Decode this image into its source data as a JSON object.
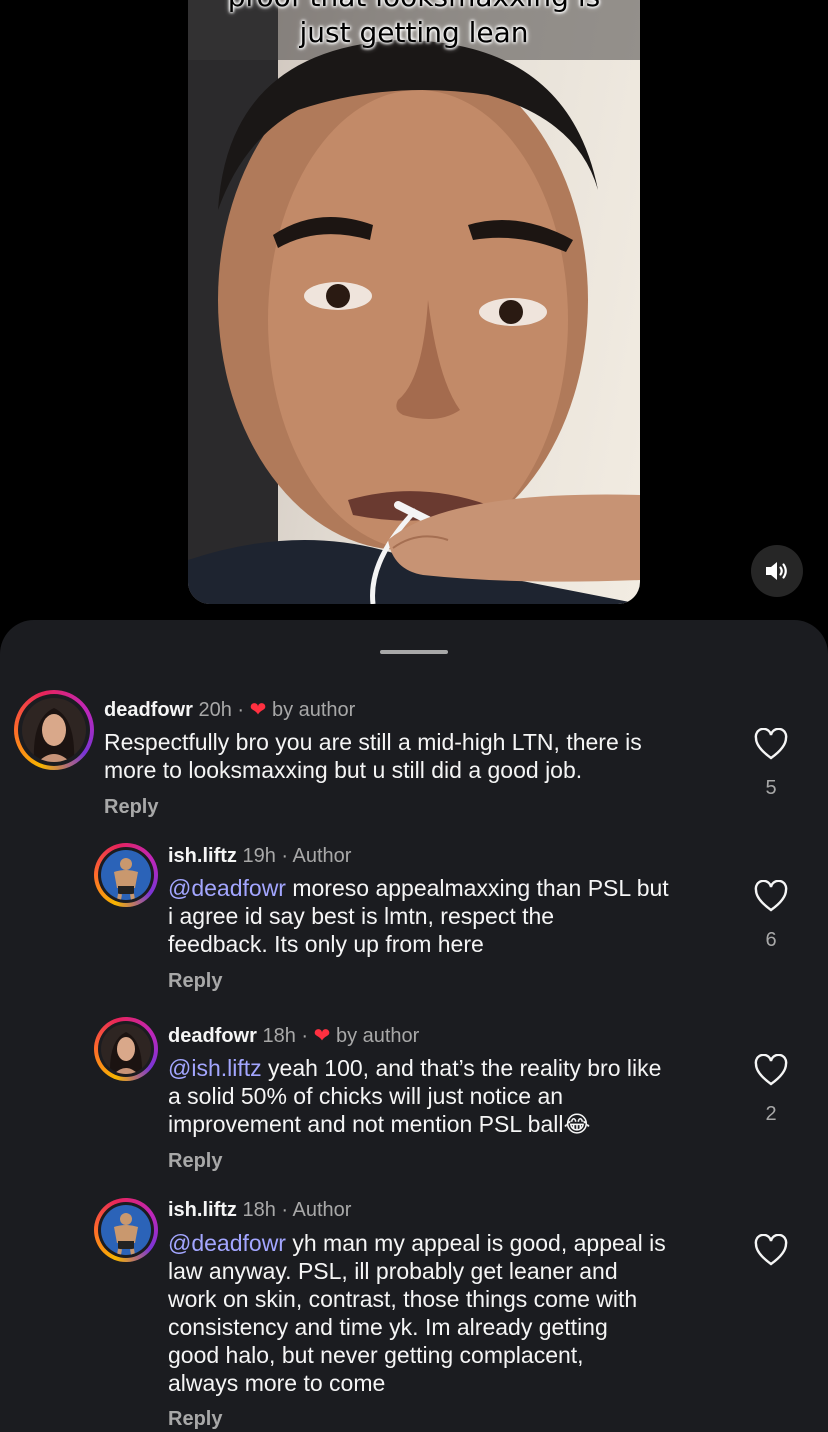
{
  "video": {
    "caption_line1": "proof that looksmaxxing is",
    "caption_line2": "just getting lean",
    "mute_icon": "speaker-volume-icon"
  },
  "comments": [
    {
      "username": "deadfowr",
      "time": "20h",
      "tag": "by author",
      "liked_by_author": true,
      "segments": [
        {
          "type": "text",
          "value": "Respectfully bro you are still a mid-high LTN, there is"
        },
        {
          "type": "text",
          "value": "more to looksmaxxing but u still did a good job."
        }
      ],
      "reply_label": "Reply",
      "likes": "5"
    },
    {
      "username": "ish.liftz",
      "time": "19h",
      "tag": "Author",
      "mention": "@deadfowr",
      "lines": [
        " moreso appealmaxxing than PSL but",
        "i agree id say best is lmtn, respect the",
        "feedback. Its only up from here"
      ],
      "reply_label": "Reply",
      "likes": "6"
    },
    {
      "username": "deadfowr",
      "time": "18h",
      "tag": "by author",
      "liked_by_author": true,
      "mention": "@ish.liftz",
      "lines": [
        " yeah 100, and that’s the reality bro like",
        "a solid 50% of chicks will just notice an",
        "improvement and not mention PSL ball"
      ],
      "emoji": "😂",
      "reply_label": "Reply",
      "likes": "2"
    },
    {
      "username": "ish.liftz",
      "time": "18h",
      "tag": "Author",
      "mention": "@deadfowr",
      "lines": [
        " yh man my appeal is good, appeal is",
        "law anyway. PSL, ill probably get leaner and",
        "work on skin, contrast, those things come with",
        "consistency and time yk. Im already getting",
        "good halo, but never getting complacent,",
        "always more to come"
      ],
      "reply_label": "Reply",
      "likes": ""
    }
  ]
}
